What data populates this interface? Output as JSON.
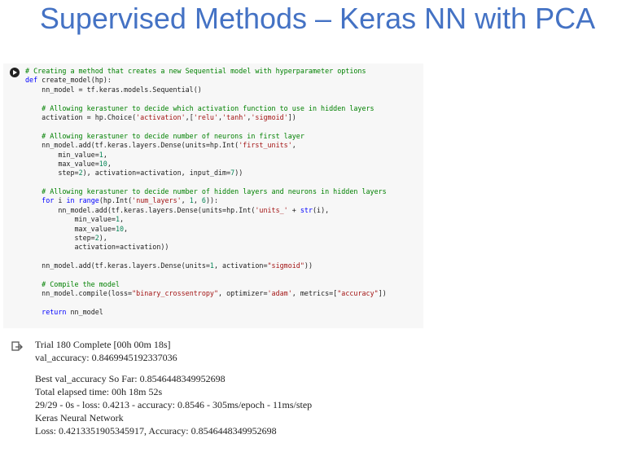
{
  "slide": {
    "title": "Supervised Methods – Keras NN with PCA"
  },
  "code_cell": {
    "lines": [
      [
        {
          "t": "# Creating a method that creates a new Sequential model with hyperparameter options",
          "c": "com"
        }
      ],
      [
        {
          "t": "def",
          "c": "kw"
        },
        {
          "t": " create_model(hp):"
        }
      ],
      [
        {
          "t": "    nn_model = tf.keras.models.Sequential()"
        }
      ],
      [],
      [
        {
          "t": "    # Allowing kerastuner to decide which activation function to use in hidden layers",
          "c": "com"
        }
      ],
      [
        {
          "t": "    activation = hp.Choice("
        },
        {
          "t": "'activation'",
          "c": "str"
        },
        {
          "t": ",["
        },
        {
          "t": "'relu'",
          "c": "str"
        },
        {
          "t": ","
        },
        {
          "t": "'tanh'",
          "c": "str"
        },
        {
          "t": ","
        },
        {
          "t": "'sigmoid'",
          "c": "str"
        },
        {
          "t": "])"
        }
      ],
      [],
      [
        {
          "t": "    # Allowing kerastuner to decide number of neurons in first layer",
          "c": "com"
        }
      ],
      [
        {
          "t": "    nn_model.add(tf.keras.layers.Dense(units=hp.Int("
        },
        {
          "t": "'first_units'",
          "c": "str"
        },
        {
          "t": ","
        }
      ],
      [
        {
          "t": "        min_value="
        },
        {
          "t": "1",
          "c": "num"
        },
        {
          "t": ","
        }
      ],
      [
        {
          "t": "        max_value="
        },
        {
          "t": "10",
          "c": "num"
        },
        {
          "t": ","
        }
      ],
      [
        {
          "t": "        step="
        },
        {
          "t": "2",
          "c": "num"
        },
        {
          "t": "), activation=activation, input_dim="
        },
        {
          "t": "7",
          "c": "num"
        },
        {
          "t": "))"
        }
      ],
      [],
      [
        {
          "t": "    # Allowing kerastuner to decide number of hidden layers and neurons in hidden layers",
          "c": "com"
        }
      ],
      [
        {
          "t": "    "
        },
        {
          "t": "for",
          "c": "kw"
        },
        {
          "t": " i "
        },
        {
          "t": "in",
          "c": "kw"
        },
        {
          "t": " "
        },
        {
          "t": "range",
          "c": "kw"
        },
        {
          "t": "(hp.Int("
        },
        {
          "t": "'num_layers'",
          "c": "str"
        },
        {
          "t": ", "
        },
        {
          "t": "1",
          "c": "num"
        },
        {
          "t": ", "
        },
        {
          "t": "6",
          "c": "num"
        },
        {
          "t": ")):"
        }
      ],
      [
        {
          "t": "        nn_model.add(tf.keras.layers.Dense(units=hp.Int("
        },
        {
          "t": "'units_'",
          "c": "str"
        },
        {
          "t": " + "
        },
        {
          "t": "str",
          "c": "kw"
        },
        {
          "t": "(i),"
        }
      ],
      [
        {
          "t": "            min_value="
        },
        {
          "t": "1",
          "c": "num"
        },
        {
          "t": ","
        }
      ],
      [
        {
          "t": "            max_value="
        },
        {
          "t": "10",
          "c": "num"
        },
        {
          "t": ","
        }
      ],
      [
        {
          "t": "            step="
        },
        {
          "t": "2",
          "c": "num"
        },
        {
          "t": "),"
        }
      ],
      [
        {
          "t": "            activation=activation))"
        }
      ],
      [],
      [
        {
          "t": "    nn_model.add(tf.keras.layers.Dense(units="
        },
        {
          "t": "1",
          "c": "num"
        },
        {
          "t": ", activation="
        },
        {
          "t": "\"sigmoid\"",
          "c": "str"
        },
        {
          "t": "))"
        }
      ],
      [],
      [
        {
          "t": "    # Compile the model",
          "c": "com"
        }
      ],
      [
        {
          "t": "    nn_model.compile(loss="
        },
        {
          "t": "\"binary_crossentropy\"",
          "c": "str"
        },
        {
          "t": ", optimizer="
        },
        {
          "t": "'adam'",
          "c": "str"
        },
        {
          "t": ", metrics=["
        },
        {
          "t": "\"accuracy\"",
          "c": "str"
        },
        {
          "t": "])"
        }
      ],
      [],
      [
        {
          "t": "    "
        },
        {
          "t": "return",
          "c": "kw"
        },
        {
          "t": " nn_model"
        }
      ]
    ]
  },
  "output": {
    "lines": [
      "Trial 180 Complete [00h 00m 18s]",
      "val_accuracy: 0.8469945192337036",
      "",
      "Best val_accuracy So Far: 0.8546448349952698",
      "Total elapsed time: 00h 18m 52s",
      "29/29 - 0s - loss: 0.4213 - accuracy: 0.8546 - 305ms/epoch - 11ms/step",
      "Keras Neural Network",
      "Loss: 0.4213351905345917, Accuracy: 0.8546448349952698"
    ]
  },
  "icons": {
    "run": "play-circle-icon",
    "output": "output-arrow-icon"
  },
  "colors": {
    "title": "#4472c4",
    "comment": "#008000",
    "keyword": "#0000ff",
    "string": "#a31515",
    "number": "#098658",
    "cell_bg": "#f7f7f7"
  }
}
